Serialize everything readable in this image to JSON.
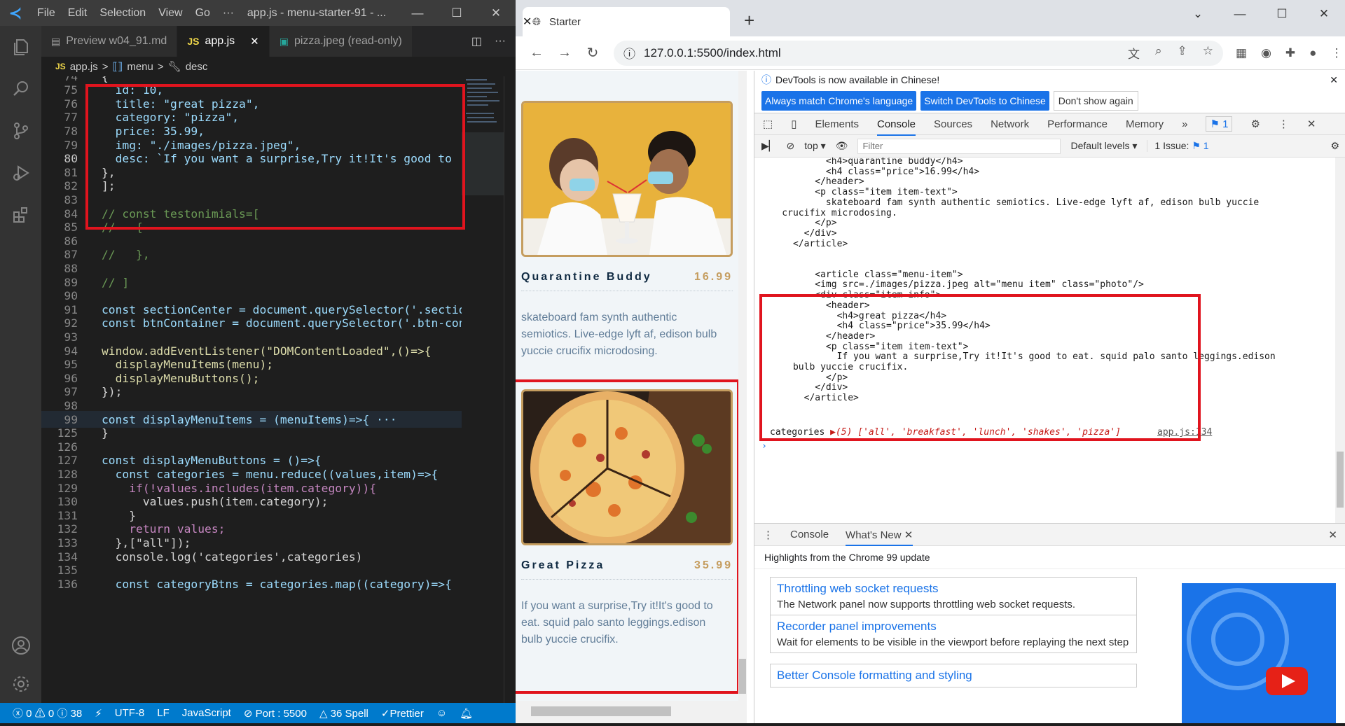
{
  "vscode": {
    "menu": [
      "File",
      "Edit",
      "Selection",
      "View",
      "Go",
      "···"
    ],
    "window_title": "app.js - menu-starter-91 - ...",
    "tabs": [
      {
        "label": "Preview w04_91.md",
        "icon": "preview-icon"
      },
      {
        "label": "app.js",
        "icon": "js-icon"
      },
      {
        "label": "pizza.jpeg (read-only)",
        "icon": "image-icon"
      }
    ],
    "breadcrumb": [
      "app.js",
      ">",
      "menu",
      ">",
      "desc"
    ],
    "lines": [
      {
        "n": "74",
        "code": "{"
      },
      {
        "n": "75",
        "code": "  id: 10,"
      },
      {
        "n": "76",
        "code": "  title: \"great pizza\","
      },
      {
        "n": "77",
        "code": "  category: \"pizza\","
      },
      {
        "n": "78",
        "code": "  price: 35.99,"
      },
      {
        "n": "79",
        "code": "  img: \"./images/pizza.jpeg\","
      },
      {
        "n": "80",
        "code": "  desc: `If you want a surprise,Try it!It's good to"
      },
      {
        "n": "81",
        "code": "},"
      },
      {
        "n": "82",
        "code": "];"
      },
      {
        "n": "83",
        "code": ""
      },
      {
        "n": "84",
        "code": "// const testonimials=["
      },
      {
        "n": "85",
        "code": "//   {"
      },
      {
        "n": "86",
        "code": ""
      },
      {
        "n": "87",
        "code": "//   },"
      },
      {
        "n": "88",
        "code": ""
      },
      {
        "n": "89",
        "code": "// ]"
      },
      {
        "n": "90",
        "code": ""
      },
      {
        "n": "91",
        "code": "const sectionCenter = document.querySelector('.sectio"
      },
      {
        "n": "92",
        "code": "const btnContainer = document.querySelector('.btn-con"
      },
      {
        "n": "93",
        "code": ""
      },
      {
        "n": "94",
        "code": "window.addEventListener(\"DOMContentLoaded\",()=>{"
      },
      {
        "n": "95",
        "code": "  displayMenuItems(menu);"
      },
      {
        "n": "96",
        "code": "  displayMenuButtons();"
      },
      {
        "n": "97",
        "code": "});"
      },
      {
        "n": "98",
        "code": ""
      },
      {
        "n": "99",
        "code": "const displayMenuItems = (menuItems)=>{ ···"
      },
      {
        "n": "125",
        "code": "}"
      },
      {
        "n": "126",
        "code": ""
      },
      {
        "n": "127",
        "code": "const displayMenuButtons = ()=>{"
      },
      {
        "n": "128",
        "code": "  const categories = menu.reduce((values,item)=>{"
      },
      {
        "n": "129",
        "code": "    if(!values.includes(item.category)){"
      },
      {
        "n": "130",
        "code": "      values.push(item.category);"
      },
      {
        "n": "131",
        "code": "    }"
      },
      {
        "n": "132",
        "code": "    return values;"
      },
      {
        "n": "133",
        "code": "  },[\"all\"]);"
      },
      {
        "n": "134",
        "code": "  console.log('categories',categories)"
      },
      {
        "n": "135",
        "code": ""
      },
      {
        "n": "136",
        "code": "  const categoryBtns = categories.map((category)=>{"
      }
    ],
    "status": {
      "errors": "0",
      "warnings": "0",
      "info": "38",
      "encoding": "UTF-8",
      "eol": "LF",
      "language": "JavaScript",
      "port": "Port : 5500",
      "spell": "36 Spell",
      "prettier": "Prettier"
    }
  },
  "browser": {
    "tab_title": "Starter",
    "url": "127.0.0.1:5500/index.html",
    "items": [
      {
        "title": "Quarantine Buddy",
        "price": "16.99",
        "text": "skateboard fam synth authentic semiotics. Live-edge lyft af, edison bulb yuccie crucifix microdosing."
      },
      {
        "title": "Great Pizza",
        "price": "35.99",
        "text": "If you want a surprise,Try it!It's good to eat. squid palo santo leggings.edison bulb yuccie crucifix."
      }
    ]
  },
  "devtools": {
    "info": "DevTools is now available in Chinese!",
    "btn_match": "Always match Chrome's language",
    "btn_switch": "Switch DevTools to Chinese",
    "btn_dont": "Don't show again",
    "panels": [
      "Elements",
      "Console",
      "Sources",
      "Network",
      "Performance",
      "Memory",
      "»"
    ],
    "issues_badge": "1",
    "context": "top",
    "filter_placeholder": "Filter",
    "levels": "Default levels",
    "issue_count": "1 Issue:",
    "issue_num": "1",
    "console_lines": [
      "            <h4>quarantine buddy</h4>",
      "            <h4 class=\"price\">16.99</h4>",
      "          </header>",
      "          <p class=\"item item-text\">",
      "            skateboard fam synth authentic semiotics. Live-edge lyft af, edison bulb yuccie",
      "    crucifix microdosing.",
      "          </p>",
      "        </div>",
      "      </article>",
      "",
      "",
      "          <article class=\"menu-item\">",
      "          <img src=./images/pizza.jpeg alt=\"menu item\" class=\"photo\"/>",
      "          <div class=\"item-info\">",
      "            <header>",
      "              <h4>great pizza</h4>",
      "              <h4 class=\"price\">35.99</h4>",
      "            </header>",
      "            <p class=\"item item-text\">",
      "              If you want a surprise,Try it!It's good to eat. squid palo santo leggings.edison",
      "      bulb yuccie crucifix.",
      "            </p>",
      "          </div>",
      "        </article>"
    ],
    "categories_label": "categories",
    "categories_value": "▶(5) ['all', 'breakfast', 'lunch', 'shakes', 'pizza']",
    "categories_src": "app.js:134",
    "prompt": "›",
    "drawer_tabs": [
      "Console",
      "What's New"
    ],
    "highlights": "Highlights from the Chrome 99 update",
    "news": [
      {
        "title": "Throttling web socket requests",
        "desc": "The Network panel now supports throttling web socket requests."
      },
      {
        "title": "Recorder panel improvements",
        "desc": "Wait for elements to be visible in the viewport before replaying the next step"
      },
      {
        "title": "Better Console formatting and styling",
        "desc": ""
      }
    ]
  }
}
